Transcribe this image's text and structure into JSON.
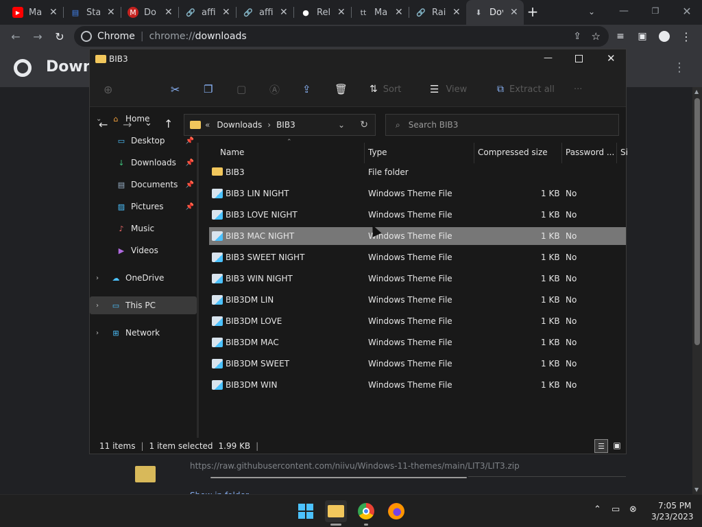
{
  "browser": {
    "tabs": [
      {
        "title": "Ma",
        "icon": "youtube-icon",
        "color": "#ff0000"
      },
      {
        "title": "Sta",
        "icon": "document-icon",
        "color": "#4285f4"
      },
      {
        "title": "Do",
        "icon": "gmail-icon",
        "color": "#ea4335"
      },
      {
        "title": "affi",
        "icon": "link-icon",
        "color": "#bdc1c6"
      },
      {
        "title": "affi",
        "icon": "link-icon",
        "color": "#bdc1c6"
      },
      {
        "title": "Rel",
        "icon": "github-icon",
        "color": "#ffffff"
      },
      {
        "title": "Ma",
        "icon": "tt-icon",
        "color": "#bdc1c6"
      },
      {
        "title": "Rai",
        "icon": "link-icon",
        "color": "#bdc1c6"
      },
      {
        "title": "Dov",
        "icon": "download-icon",
        "color": "#bdc1c6"
      }
    ],
    "url_host": "Chrome",
    "url_scheme": "chrome://",
    "url_path": "downloads",
    "page_title": "Downl",
    "download_url": "https://raw.githubusercontent.com/niivu/Windows-11-themes/main/LIT3/LIT3.zip",
    "download_action": "Show in folder"
  },
  "explorer": {
    "window_title": "BIB3",
    "toolbar": {
      "sort": "Sort",
      "view": "View",
      "extract_all": "Extract all",
      "more": "···"
    },
    "breadcrumb": {
      "root_chev": "«",
      "parent": "Downloads",
      "current": "BIB3"
    },
    "search_placeholder": "Search BIB3",
    "nav": [
      {
        "label": "Home",
        "icon": "home-icon"
      },
      {
        "label": "Desktop",
        "icon": "desktop-icon"
      },
      {
        "label": "Downloads",
        "icon": "downloads-icon"
      },
      {
        "label": "Documents",
        "icon": "documents-icon"
      },
      {
        "label": "Pictures",
        "icon": "pictures-icon"
      },
      {
        "label": "Music",
        "icon": "music-icon"
      },
      {
        "label": "Videos",
        "icon": "videos-icon"
      },
      {
        "label": "OneDrive",
        "icon": "onedrive-icon"
      },
      {
        "label": "This PC",
        "icon": "this-pc-icon"
      },
      {
        "label": "Network",
        "icon": "network-icon"
      }
    ],
    "columns": {
      "name": "Name",
      "type": "Type",
      "compressed_size": "Compressed size",
      "password": "Password ...",
      "size": "Si"
    },
    "files": [
      {
        "name": "BIB3",
        "type": "File folder",
        "size": "",
        "password": ""
      },
      {
        "name": "BIB3 LIN NIGHT",
        "type": "Windows Theme File",
        "size": "1 KB",
        "password": "No"
      },
      {
        "name": "BIB3 LOVE NIGHT",
        "type": "Windows Theme File",
        "size": "1 KB",
        "password": "No"
      },
      {
        "name": "BIB3 MAC NIGHT",
        "type": "Windows Theme File",
        "size": "1 KB",
        "password": "No"
      },
      {
        "name": "BIB3 SWEET NIGHT",
        "type": "Windows Theme File",
        "size": "1 KB",
        "password": "No"
      },
      {
        "name": "BIB3 WIN NIGHT",
        "type": "Windows Theme File",
        "size": "1 KB",
        "password": "No"
      },
      {
        "name": "BIB3DM LIN",
        "type": "Windows Theme File",
        "size": "1 KB",
        "password": "No"
      },
      {
        "name": "BIB3DM LOVE",
        "type": "Windows Theme File",
        "size": "1 KB",
        "password": "No"
      },
      {
        "name": "BIB3DM MAC",
        "type": "Windows Theme File",
        "size": "1 KB",
        "password": "No"
      },
      {
        "name": "BIB3DM SWEET",
        "type": "Windows Theme File",
        "size": "1 KB",
        "password": "No"
      },
      {
        "name": "BIB3DM WIN",
        "type": "Windows Theme File",
        "size": "1 KB",
        "password": "No"
      }
    ],
    "selected_index": 3,
    "status": {
      "items": "11 items",
      "selected": "1 item selected",
      "size": "1.99 KB"
    }
  },
  "taskbar": {
    "time": "7:05 PM",
    "date": "3/23/2023"
  }
}
